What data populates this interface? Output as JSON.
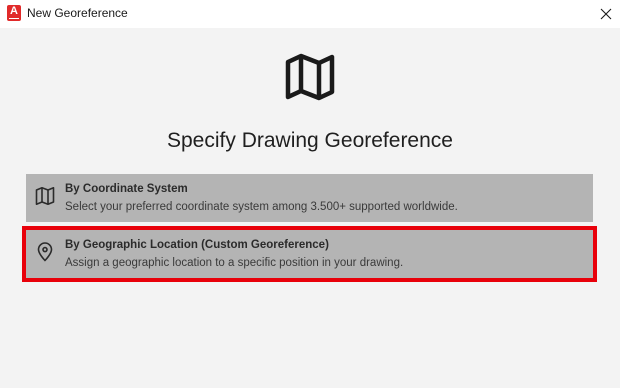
{
  "window": {
    "title": "New Georeference",
    "app_icon_letter": "A",
    "app_icon_color": "#e12a2a",
    "close_icon": "close-icon"
  },
  "main": {
    "hero_icon": "map-icon",
    "heading": "Specify Drawing Georeference"
  },
  "options": [
    {
      "icon": "map-icon",
      "title": "By Coordinate System",
      "description": "Select your preferred coordinate system among 3.500+ supported worldwide."
    },
    {
      "icon": "location-pin-icon",
      "title": "By Geographic Location (Custom Georeference)",
      "description": "Assign a geographic location to a specific position in your drawing.",
      "highlight_color": "#e8000a"
    }
  ]
}
